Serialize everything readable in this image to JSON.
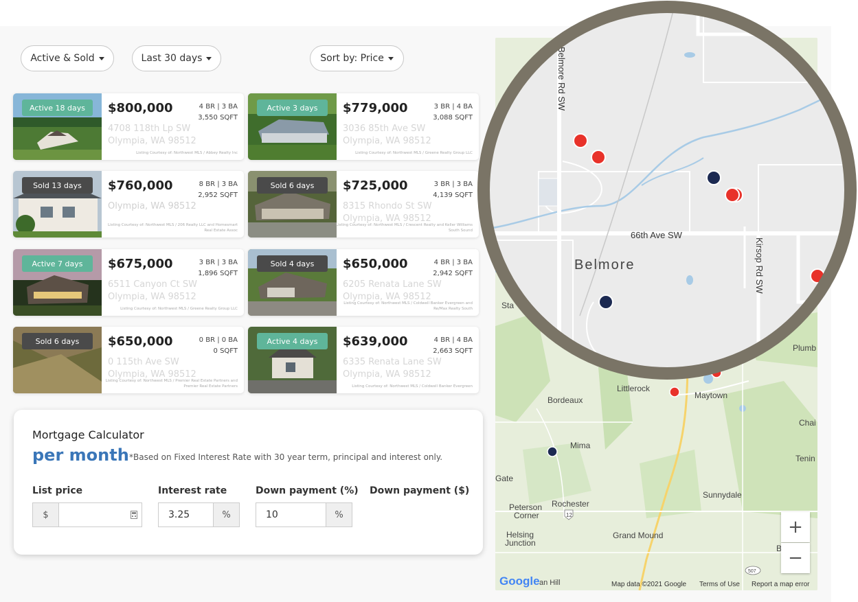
{
  "filters": {
    "status": "Active & Sold",
    "period": "Last 30 days",
    "sort": "Sort by: Price"
  },
  "listings": [
    {
      "badge": "Active 18 days",
      "badge_type": "active",
      "price": "$800,000",
      "beds_baths": "4 BR | 3 BA",
      "sqft": "3,550 SQFT",
      "address": "4708 118th Lp SW",
      "city": "Olympia, WA 98512",
      "courtesy": "Listing Courtesy of: Northwest MLS / Abbey Realty Inc"
    },
    {
      "badge": "Active 3 days",
      "badge_type": "active",
      "price": "$779,000",
      "beds_baths": "3 BR | 4 BA",
      "sqft": "3,088 SQFT",
      "address": "3036 85th Ave SW",
      "city": "Olympia, WA 98512",
      "courtesy": "Listing Courtesy of: Northwest MLS / Greene Realty Group LLC"
    },
    {
      "badge": "Sold 13 days",
      "badge_type": "sold",
      "price": "$760,000",
      "beds_baths": "8 BR | 3 BA",
      "sqft": "2,952 SQFT",
      "address": "",
      "city": "Olympia, WA 98512",
      "courtesy": "Listing Courtesy of: Northwest MLS / 206 Realty LLC and Homesmart Real Estate Assoc"
    },
    {
      "badge": "Sold 6 days",
      "badge_type": "sold",
      "price": "$725,000",
      "beds_baths": "3 BR | 3 BA",
      "sqft": "4,139 SQFT",
      "address": "8315 Rhondo St SW",
      "city": "Olympia, WA 98512",
      "courtesy": "Listing Courtesy of: Northwest MLS / Crescent Realty and Keller Williams South Sound"
    },
    {
      "badge": "Active 7 days",
      "badge_type": "active",
      "price": "$675,000",
      "beds_baths": "3 BR | 3 BA",
      "sqft": "1,896 SQFT",
      "address": "6511 Canyon Ct SW",
      "city": "Olympia, WA 98512",
      "courtesy": "Listing Courtesy of: Northwest MLS / Greene Realty Group LLC"
    },
    {
      "badge": "Sold 4 days",
      "badge_type": "sold",
      "price": "$650,000",
      "beds_baths": "4 BR | 3 BA",
      "sqft": "2,942 SQFT",
      "address": "6205 Renata Lane SW",
      "city": "Olympia, WA 98512",
      "courtesy": "Listing Courtesy of: Northwest MLS / Coldwell Banker Evergreen and Re/Max Realty South"
    },
    {
      "badge": "Sold 6 days",
      "badge_type": "sold",
      "price": "$650,000",
      "beds_baths": "0 BR | 0 BA",
      "sqft": "0 SQFT",
      "address": "0 115th Ave SW",
      "city": "Olympia, WA 98512",
      "courtesy": "Listing Courtesy of: Northwest MLS / Premier Real Estate Partners and Premier Real Estate Partners"
    },
    {
      "badge": "Active 4 days",
      "badge_type": "active",
      "price": "$639,000",
      "beds_baths": "4 BR | 4 BA",
      "sqft": "2,663 SQFT",
      "address": "6335 Renata Lane SW",
      "city": "Olympia, WA 98512",
      "courtesy": "Listing Courtesy of: Northwest MLS / Coldwell Banker Evergreen"
    }
  ],
  "calculator": {
    "title": "Mortgage Calculator",
    "per_month": "per month",
    "note": "*Based on Fixed Interest Rate with 30 year term, principal and interest only.",
    "list_price_label": "List price",
    "list_price_prefix": "$",
    "list_price_value": "",
    "interest_label": "Interest rate",
    "interest_value": "3.25",
    "interest_suffix": "%",
    "down_pct_label": "Down payment (%)",
    "down_pct_value": "10",
    "down_pct_suffix": "%",
    "down_amt_label": "Down payment ($)"
  },
  "map": {
    "labels": {
      "littlerock": "Littlerock",
      "maytown": "Maytown",
      "bordeaux": "Bordeaux",
      "mima": "Mima",
      "sunnydale": "Sunnydale",
      "peterson": "Peterson",
      "corner": "Corner",
      "rochester": "Rochester",
      "route": "12",
      "helsing": "Helsing",
      "junction": "Junction",
      "grand_mound": "Grand Mound",
      "gate": "Gate",
      "plumb": "Plumb",
      "chai": "Chai",
      "tenin": "Tenin",
      "route2": "507",
      "b": "B",
      "stub": "Sta",
      "hill": "an Hill"
    },
    "zoom_in": "+",
    "zoom_out": "−",
    "logo": "Google",
    "map_data": "Map data ©2021 Google",
    "terms": "Terms of Use",
    "report": "Report a map error"
  },
  "lens": {
    "belmore_rd": "Belmore Rd SW",
    "ave_66": "66th Ave SW",
    "belmore": "Belmore",
    "kirsop": "Kirsop Rd SW"
  },
  "colors": {
    "active": "#5fb59a",
    "sold": "#4a4a4a",
    "accent": "#3a76b8",
    "pin_red": "#e8322a",
    "pin_navy": "#1c2a52",
    "lens_ring": "#7a7466"
  }
}
